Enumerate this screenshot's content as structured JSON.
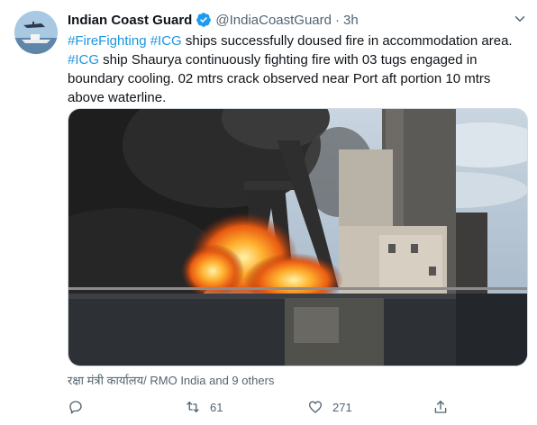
{
  "tweet": {
    "author_name": "Indian Coast Guard",
    "handle": "@IndiaCoastGuard",
    "separator": "·",
    "time": "3h",
    "text_segments": [
      {
        "text": "#FireFighting",
        "hashtag": true
      },
      {
        "text": " ",
        "hashtag": false
      },
      {
        "text": "#ICG",
        "hashtag": true
      },
      {
        "text": " ships successfully doused fire in accommodation area. ",
        "hashtag": false
      },
      {
        "text": "#ICG",
        "hashtag": true
      },
      {
        "text": " ship Shaurya continuously fighting fire with 03 tugs engaged in boundary cooling. 02 mtrs crack observed near Port aft portion 10 mtrs above waterline.",
        "hashtag": false
      }
    ],
    "liked_by": "रक्षा मंत्री कार्यालय/ RMO India and 9 others",
    "actions": {
      "reply_count": "",
      "retweet_count": "61",
      "like_count": "271",
      "share_count": ""
    }
  },
  "colors": {
    "hashtag": "#1b95e0",
    "verified": "#1d9bf0",
    "secondary_text": "#536471",
    "primary_text": "#0f1419"
  },
  "icons": [
    "verified-badge-icon",
    "chevron-down-icon",
    "reply-icon",
    "retweet-icon",
    "like-icon",
    "share-icon"
  ]
}
